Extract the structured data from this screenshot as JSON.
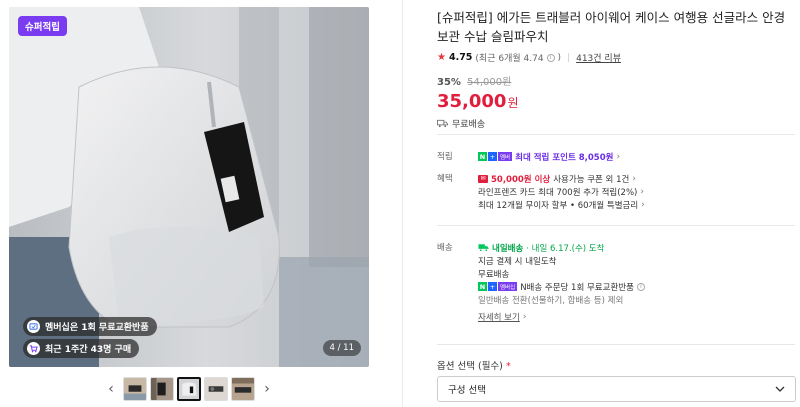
{
  "gallery": {
    "super_badge": "슈퍼적립",
    "chips": [
      {
        "text": "멤버십은 1회 무료교환반품",
        "icon": "membership-icon"
      },
      {
        "text": "최근 1주간 43명 구매",
        "icon": "cart-icon"
      }
    ],
    "counter": "4 / 11",
    "prev": "‹",
    "next": "›"
  },
  "product": {
    "title": "[슈퍼적립] 에가든 트래블러 아이웨어 케이스 여행용 선글라스 안경 보관 수납 슬림파우치",
    "rating": "4.75",
    "rating_recent": "(최근 6개월 4.74",
    "review_count": "413건 리뷰",
    "discount_pct": "35%",
    "original_price": "54,000원",
    "price": "35,000",
    "currency": "원",
    "shipping_short": "무료배송"
  },
  "benefits": {
    "points_label": "적립",
    "npay_tag": "멤버",
    "points_text": "최대 적립 포인트 8,050원",
    "perks_label": "혜택",
    "coupon_amount": "50,000원 이상",
    "coupon_rest": "사용가능 쿠폰 외 1건",
    "card_text": "라인프렌즈 카드 최대 700원 추가 적립(2%)",
    "installment_text": "최대 12개월 무이자 할부 • 60개월 특별금리"
  },
  "delivery": {
    "label": "배송",
    "fast_label": "내일배송",
    "arrival": "· 내일 6.17.(수) 도착",
    "pay_now": "지금 결제 시 내일도착",
    "free": "무료배송",
    "npay_tag": "멤버십",
    "npay_return": "N배송 주문당 1회 무료교환반품",
    "normal_switch": "일반배송 전환(선물하기, 합배송 등) 제외",
    "details": "자세히 보기"
  },
  "options": {
    "label": "옵션 선택 (필수)",
    "required_mark": "*",
    "select_value": "구성 선택"
  },
  "colors": {
    "accent_red": "#e11e3c",
    "super_purple": "#7a3cf0",
    "npay_green": "#03c75a"
  }
}
